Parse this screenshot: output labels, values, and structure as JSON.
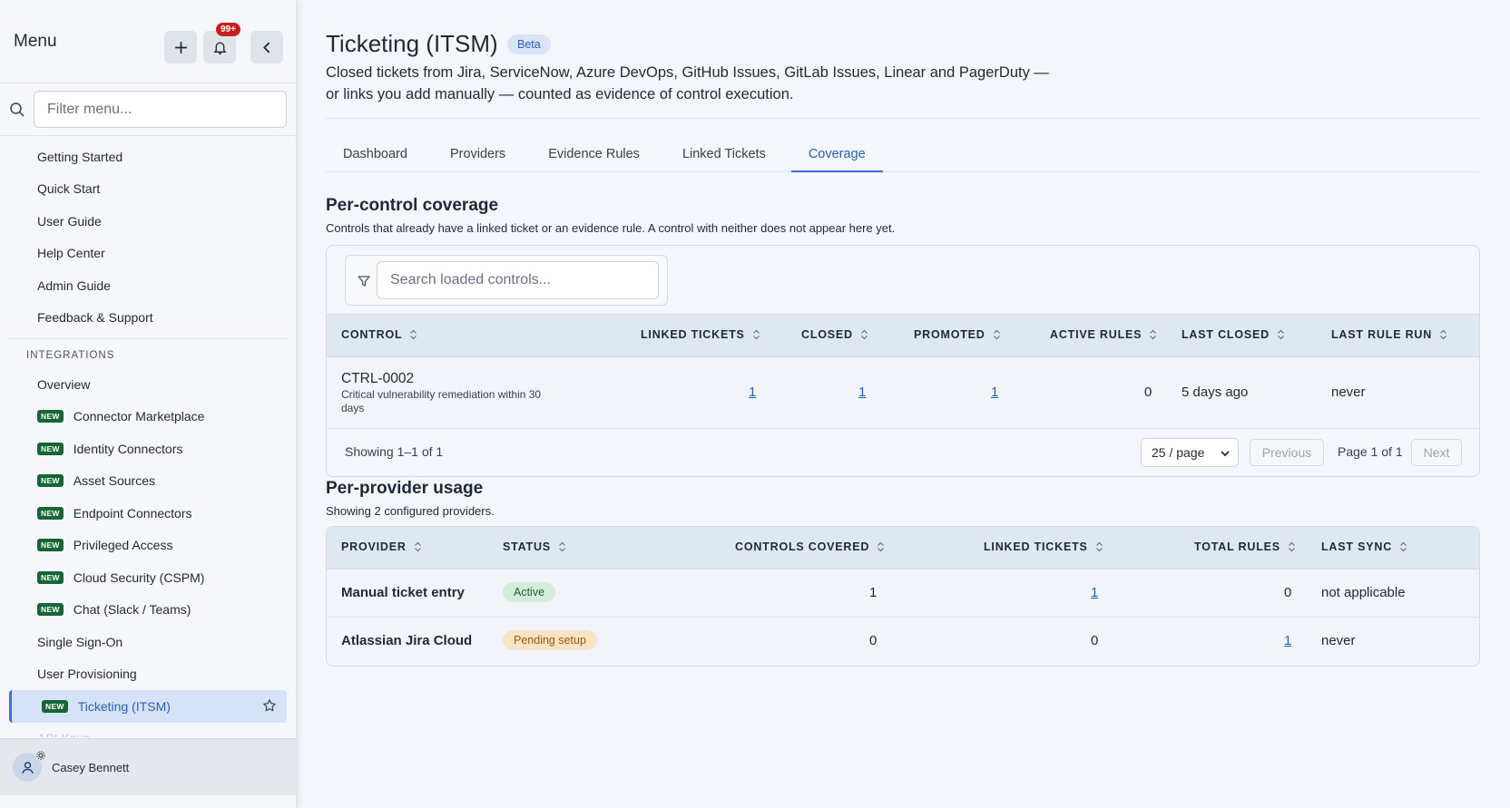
{
  "sidebar": {
    "title": "Menu",
    "notifications_count": "99+",
    "search_placeholder": "Filter menu...",
    "items_top": [
      "Getting Started",
      "Quick Start",
      "User Guide",
      "Help Center",
      "Admin Guide",
      "Feedback & Support"
    ],
    "section_label": "INTEGRATIONS",
    "overview": "Overview",
    "new_tag": "NEW",
    "new_items": [
      "Connector Marketplace",
      "Identity Connectors",
      "Asset Sources",
      "Endpoint Connectors",
      "Privileged Access",
      "Cloud Security (CSPM)",
      "Chat (Slack / Teams)"
    ],
    "plain_items": [
      "Single Sign-On",
      "User Provisioning"
    ],
    "active_item": "Ticketing (ITSM)",
    "faded_item": "API Keys",
    "user_name": "Casey Bennett"
  },
  "page": {
    "title": "Ticketing (ITSM)",
    "badge": "Beta",
    "description": "Closed tickets from Jira, ServiceNow, Azure DevOps, GitHub Issues, GitLab Issues, Linear and PagerDuty — or links you add manually — counted as evidence of control execution."
  },
  "tabs": [
    "Dashboard",
    "Providers",
    "Evidence Rules",
    "Linked Tickets",
    "Coverage"
  ],
  "active_tab": "Coverage",
  "coverage": {
    "title": "Per-control coverage",
    "subtitle": "Controls that already have a linked ticket or an evidence rule. A control with neither does not appear here yet.",
    "search_placeholder": "Search loaded controls...",
    "columns": [
      "CONTROL",
      "LINKED TICKETS",
      "CLOSED",
      "PROMOTED",
      "ACTIVE RULES",
      "LAST CLOSED",
      "LAST RULE RUN"
    ],
    "rows": [
      {
        "control_id": "CTRL-0002",
        "control_desc": "Critical vulnerability remediation within 30 days",
        "linked": "1",
        "closed": "1",
        "promoted": "1",
        "active_rules": "0",
        "last_closed": "5 days ago",
        "last_rule_run": "never"
      }
    ],
    "showing": "Showing 1–1 of 1",
    "per_page": "25 / page",
    "previous": "Previous",
    "page_info": "Page 1 of 1",
    "next": "Next"
  },
  "usage": {
    "title": "Per-provider usage",
    "subtitle": "Showing 2 configured providers.",
    "columns": [
      "PROVIDER",
      "STATUS",
      "CONTROLS COVERED",
      "LINKED TICKETS",
      "TOTAL RULES",
      "LAST SYNC"
    ],
    "rows": [
      {
        "provider": "Manual ticket entry",
        "status": "Active",
        "controls": "1",
        "linked": "1",
        "rules": "0",
        "last_sync": "not applicable"
      },
      {
        "provider": "Atlassian Jira Cloud",
        "status": "Pending setup",
        "controls": "0",
        "linked": "0",
        "rules": "1",
        "last_sync": "never"
      }
    ]
  },
  "colors": {
    "accent": "#3b6fd0",
    "new_tag": "#166534",
    "badge_red": "#c81e1e"
  }
}
